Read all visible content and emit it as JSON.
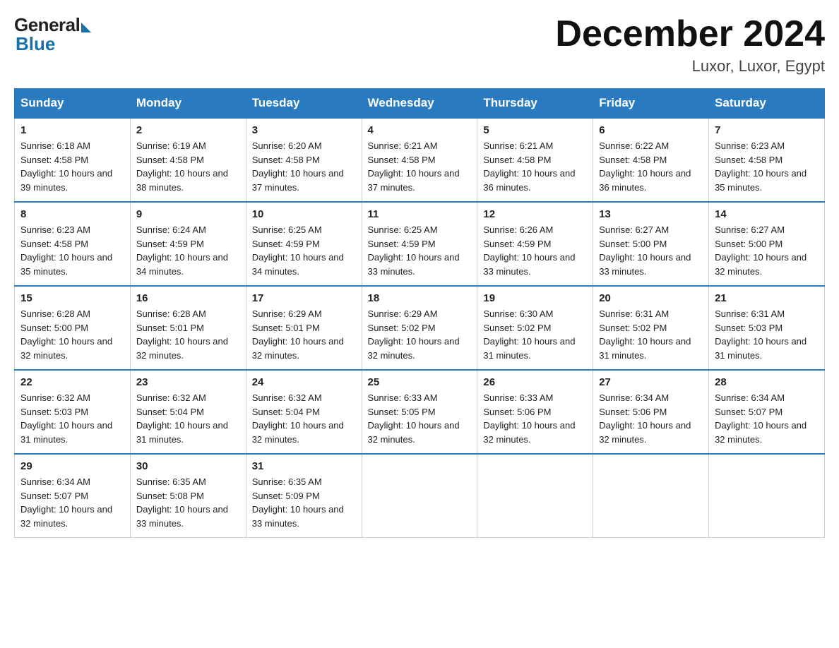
{
  "header": {
    "logo_general": "General",
    "logo_blue": "Blue",
    "month_title": "December 2024",
    "location": "Luxor, Luxor, Egypt"
  },
  "weekdays": [
    "Sunday",
    "Monday",
    "Tuesday",
    "Wednesday",
    "Thursday",
    "Friday",
    "Saturday"
  ],
  "weeks": [
    [
      {
        "day": "1",
        "sunrise": "6:18 AM",
        "sunset": "4:58 PM",
        "daylight": "10 hours and 39 minutes."
      },
      {
        "day": "2",
        "sunrise": "6:19 AM",
        "sunset": "4:58 PM",
        "daylight": "10 hours and 38 minutes."
      },
      {
        "day": "3",
        "sunrise": "6:20 AM",
        "sunset": "4:58 PM",
        "daylight": "10 hours and 37 minutes."
      },
      {
        "day": "4",
        "sunrise": "6:21 AM",
        "sunset": "4:58 PM",
        "daylight": "10 hours and 37 minutes."
      },
      {
        "day": "5",
        "sunrise": "6:21 AM",
        "sunset": "4:58 PM",
        "daylight": "10 hours and 36 minutes."
      },
      {
        "day": "6",
        "sunrise": "6:22 AM",
        "sunset": "4:58 PM",
        "daylight": "10 hours and 36 minutes."
      },
      {
        "day": "7",
        "sunrise": "6:23 AM",
        "sunset": "4:58 PM",
        "daylight": "10 hours and 35 minutes."
      }
    ],
    [
      {
        "day": "8",
        "sunrise": "6:23 AM",
        "sunset": "4:58 PM",
        "daylight": "10 hours and 35 minutes."
      },
      {
        "day": "9",
        "sunrise": "6:24 AM",
        "sunset": "4:59 PM",
        "daylight": "10 hours and 34 minutes."
      },
      {
        "day": "10",
        "sunrise": "6:25 AM",
        "sunset": "4:59 PM",
        "daylight": "10 hours and 34 minutes."
      },
      {
        "day": "11",
        "sunrise": "6:25 AM",
        "sunset": "4:59 PM",
        "daylight": "10 hours and 33 minutes."
      },
      {
        "day": "12",
        "sunrise": "6:26 AM",
        "sunset": "4:59 PM",
        "daylight": "10 hours and 33 minutes."
      },
      {
        "day": "13",
        "sunrise": "6:27 AM",
        "sunset": "5:00 PM",
        "daylight": "10 hours and 33 minutes."
      },
      {
        "day": "14",
        "sunrise": "6:27 AM",
        "sunset": "5:00 PM",
        "daylight": "10 hours and 32 minutes."
      }
    ],
    [
      {
        "day": "15",
        "sunrise": "6:28 AM",
        "sunset": "5:00 PM",
        "daylight": "10 hours and 32 minutes."
      },
      {
        "day": "16",
        "sunrise": "6:28 AM",
        "sunset": "5:01 PM",
        "daylight": "10 hours and 32 minutes."
      },
      {
        "day": "17",
        "sunrise": "6:29 AM",
        "sunset": "5:01 PM",
        "daylight": "10 hours and 32 minutes."
      },
      {
        "day": "18",
        "sunrise": "6:29 AM",
        "sunset": "5:02 PM",
        "daylight": "10 hours and 32 minutes."
      },
      {
        "day": "19",
        "sunrise": "6:30 AM",
        "sunset": "5:02 PM",
        "daylight": "10 hours and 31 minutes."
      },
      {
        "day": "20",
        "sunrise": "6:31 AM",
        "sunset": "5:02 PM",
        "daylight": "10 hours and 31 minutes."
      },
      {
        "day": "21",
        "sunrise": "6:31 AM",
        "sunset": "5:03 PM",
        "daylight": "10 hours and 31 minutes."
      }
    ],
    [
      {
        "day": "22",
        "sunrise": "6:32 AM",
        "sunset": "5:03 PM",
        "daylight": "10 hours and 31 minutes."
      },
      {
        "day": "23",
        "sunrise": "6:32 AM",
        "sunset": "5:04 PM",
        "daylight": "10 hours and 31 minutes."
      },
      {
        "day": "24",
        "sunrise": "6:32 AM",
        "sunset": "5:04 PM",
        "daylight": "10 hours and 32 minutes."
      },
      {
        "day": "25",
        "sunrise": "6:33 AM",
        "sunset": "5:05 PM",
        "daylight": "10 hours and 32 minutes."
      },
      {
        "day": "26",
        "sunrise": "6:33 AM",
        "sunset": "5:06 PM",
        "daylight": "10 hours and 32 minutes."
      },
      {
        "day": "27",
        "sunrise": "6:34 AM",
        "sunset": "5:06 PM",
        "daylight": "10 hours and 32 minutes."
      },
      {
        "day": "28",
        "sunrise": "6:34 AM",
        "sunset": "5:07 PM",
        "daylight": "10 hours and 32 minutes."
      }
    ],
    [
      {
        "day": "29",
        "sunrise": "6:34 AM",
        "sunset": "5:07 PM",
        "daylight": "10 hours and 32 minutes."
      },
      {
        "day": "30",
        "sunrise": "6:35 AM",
        "sunset": "5:08 PM",
        "daylight": "10 hours and 33 minutes."
      },
      {
        "day": "31",
        "sunrise": "6:35 AM",
        "sunset": "5:09 PM",
        "daylight": "10 hours and 33 minutes."
      },
      null,
      null,
      null,
      null
    ]
  ]
}
